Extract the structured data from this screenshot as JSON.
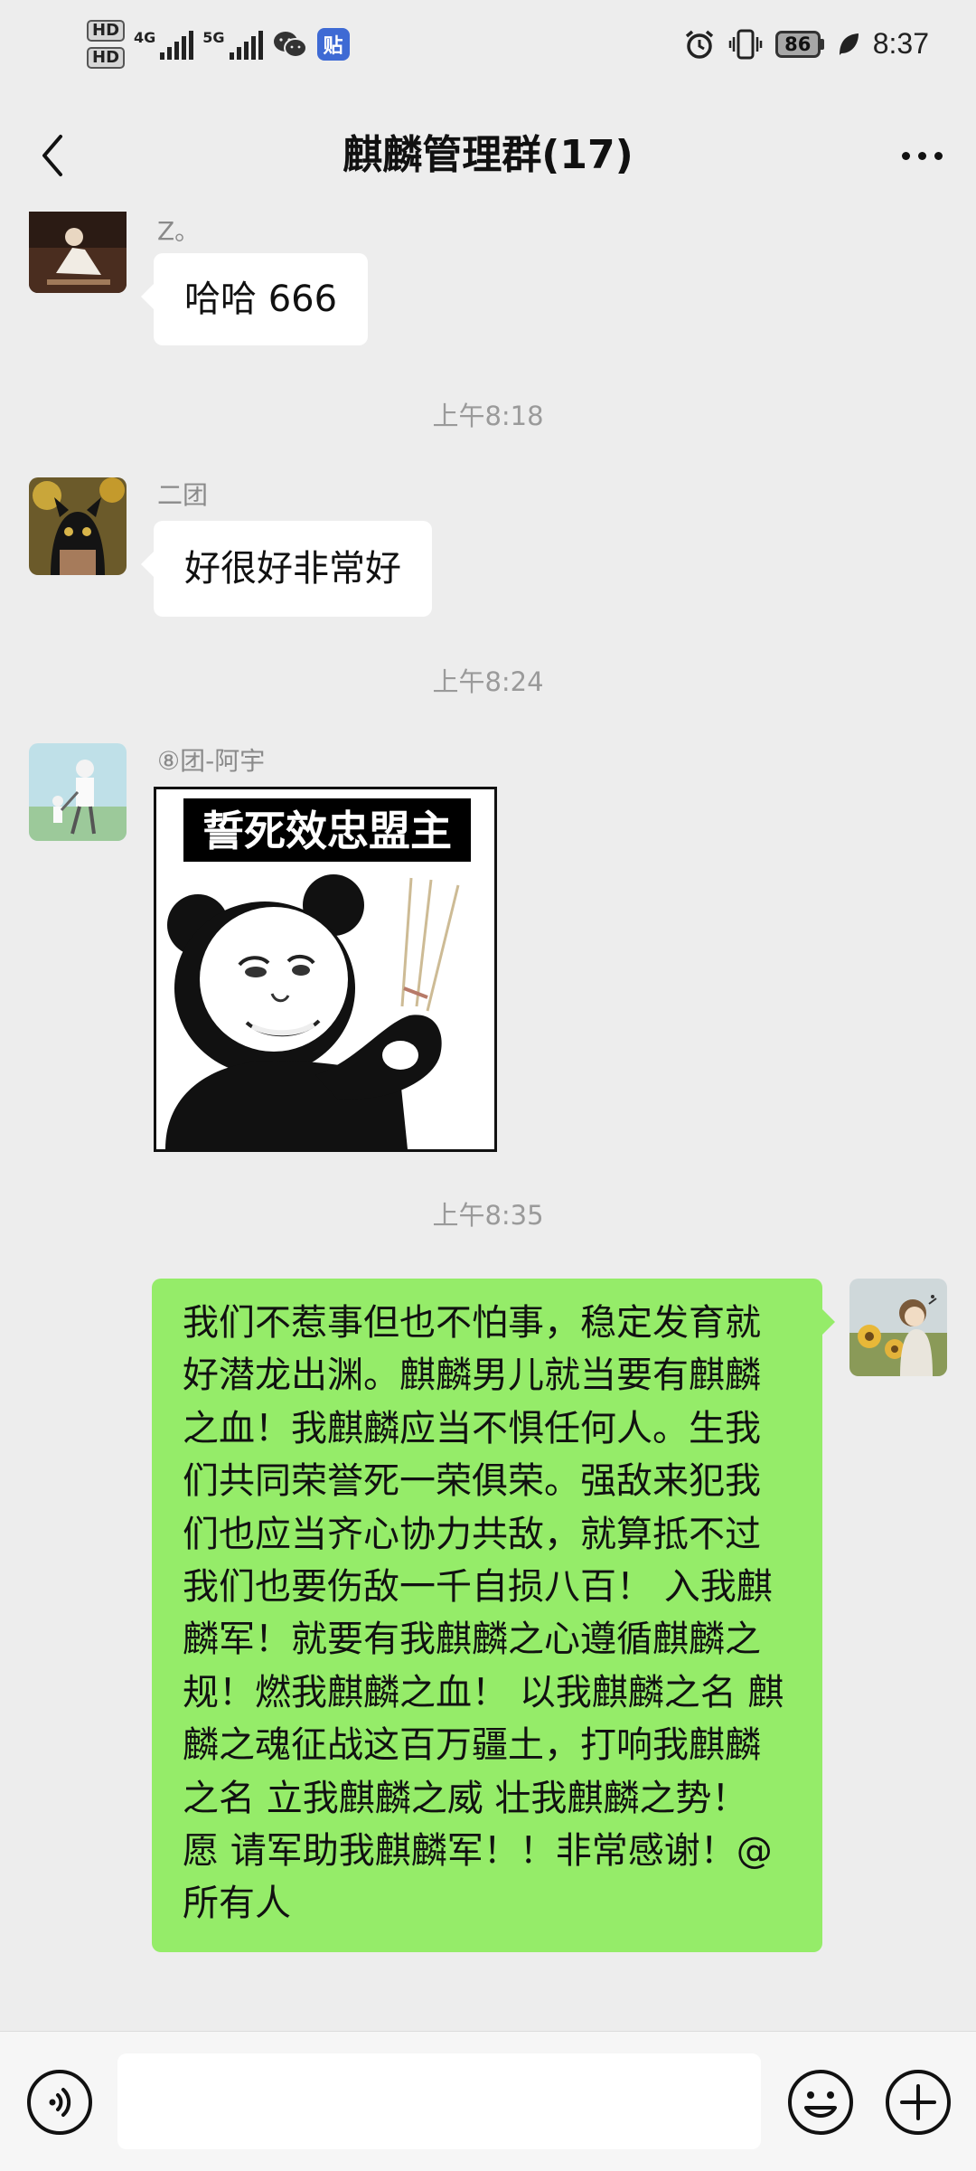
{
  "status_bar": {
    "hd1": "HD",
    "hd2": "HD",
    "net1": "4G",
    "net2": "5G",
    "app_badge": "贴",
    "battery": "86",
    "time": "8:37"
  },
  "header": {
    "title": "麒麟管理群(17)"
  },
  "messages": [
    {
      "sender": "Z。",
      "text": "哈哈 666"
    },
    {
      "time": "上午8:18"
    },
    {
      "sender": "二团",
      "text": "好很好非常好"
    },
    {
      "time": "上午8:24"
    },
    {
      "sender": "⑧团-阿宇",
      "sticker_caption": "誓死效忠盟主"
    },
    {
      "time": "上午8:35"
    },
    {
      "text": "我们不惹事但也不怕事，稳定发育就好潜龙出渊。麒麟男儿就当要有麒麟之血！我麒麟应当不惧任何人。生我们共同荣誉死一荣俱荣。强敌来犯我们也应当齐心协力共敌，就算抵不过我们也要伤敌一千自损八百！ 入我麒麟军！就要有我麒麟之心遵循麒麟之规！燃我麒麟之血！ 以我麒麟之名 麒麟之魂征战这百万疆土，打响我麒麟之名 立我麒麟之威 壮我麒麟之势！ 愿 请军助我麒麟军！！非常感谢！@所有人"
    }
  ],
  "icons": {
    "back": "chevron-left-icon",
    "more": "more-dots-icon",
    "voice": "voice-icon",
    "emoji": "emoji-icon",
    "plus": "plus-icon"
  },
  "colors": {
    "background": "#ededed",
    "incoming_bubble": "#ffffff",
    "outgoing_bubble": "#95ec69"
  }
}
